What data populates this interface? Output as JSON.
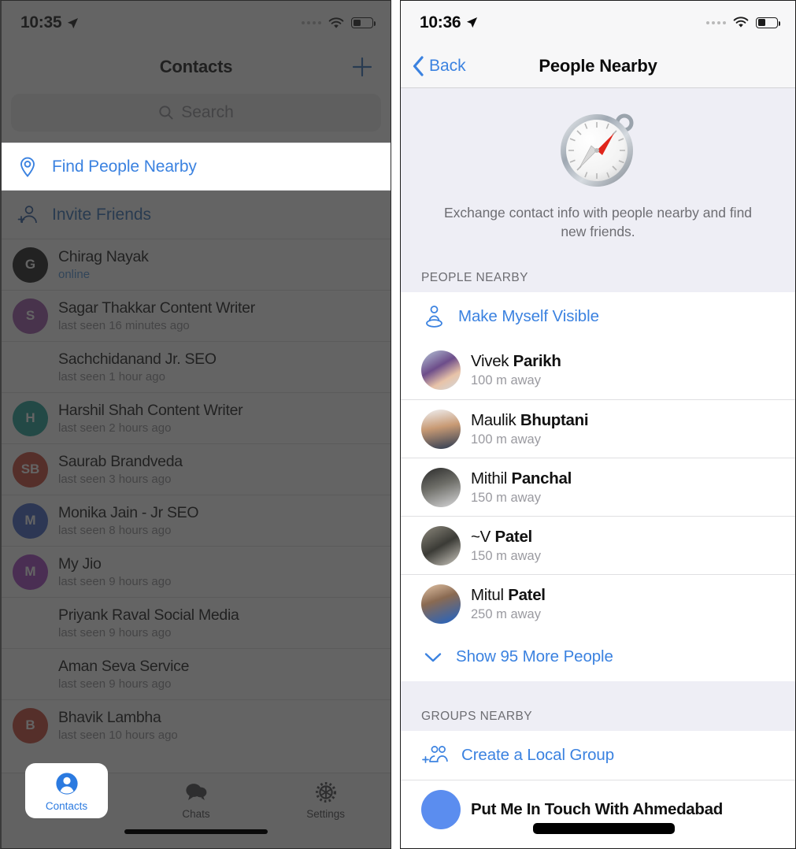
{
  "left": {
    "statusbar": {
      "time": "10:35",
      "location_icon": "location-arrow-icon",
      "signal_icon": "cell-signal-dots-icon",
      "wifi_icon": "wifi-icon",
      "battery_icon": "battery-icon"
    },
    "nav": {
      "title": "Contacts",
      "add_icon": "plus-icon"
    },
    "search": {
      "placeholder": "Search",
      "icon": "search-icon"
    },
    "find_nearby": {
      "label": "Find People Nearby",
      "icon": "location-pin-icon"
    },
    "invite": {
      "label": "Invite Friends",
      "icon": "add-person-icon"
    },
    "contacts": [
      {
        "name": "Chirag Nayak",
        "status": "online",
        "online": true,
        "initials": "G",
        "color": "#121212"
      },
      {
        "name": "Sagar Thakkar Content Writer",
        "status": "last seen 16 minutes ago",
        "online": false,
        "initials": "S",
        "color": "#9b4fa8"
      },
      {
        "name": "Sachchidanand Jr. SEO",
        "status": "last seen 1 hour ago",
        "online": false,
        "initials": "",
        "color": "transparent"
      },
      {
        "name": "Harshil Shah Content Writer",
        "status": "last seen 2 hours ago",
        "online": false,
        "initials": "H",
        "color": "#169e92"
      },
      {
        "name": "Saurab Brandveda",
        "status": "last seen 3 hours ago",
        "online": false,
        "initials": "SB",
        "color": "#c9402f"
      },
      {
        "name": "Monika Jain - Jr SEO",
        "status": "last seen 8 hours ago",
        "online": false,
        "initials": "M",
        "color": "#3b5fc4"
      },
      {
        "name": "My Jio",
        "status": "last seen 9 hours ago",
        "online": false,
        "initials": "M",
        "color": "#a03fc0"
      },
      {
        "name": "Priyank Raval Social Media",
        "status": "last seen 9 hours ago",
        "online": false,
        "initials": "",
        "color": "transparent"
      },
      {
        "name": "Aman Seva Service",
        "status": "last seen 9 hours ago",
        "online": false,
        "initials": "",
        "color": "transparent"
      },
      {
        "name": "Bhavik Lambha",
        "status": "last seen 10 hours ago",
        "online": false,
        "initials": "B",
        "color": "#c9402f"
      }
    ],
    "tabs": [
      {
        "label": "Contacts",
        "icon": "person-circle-icon",
        "active": true
      },
      {
        "label": "Chats",
        "icon": "chat-bubbles-icon",
        "active": false
      },
      {
        "label": "Settings",
        "icon": "gear-icon",
        "active": false
      }
    ]
  },
  "right": {
    "statusbar": {
      "time": "10:36",
      "location_icon": "location-arrow-icon",
      "signal_icon": "cell-signal-dots-icon",
      "wifi_icon": "wifi-icon",
      "battery_icon": "battery-icon"
    },
    "nav": {
      "back_label": "Back",
      "back_icon": "chevron-left-icon",
      "title": "People Nearby"
    },
    "hero": {
      "icon": "compass-icon",
      "text": "Exchange contact info with people nearby and find new friends."
    },
    "people_section": {
      "header": "PEOPLE NEARBY",
      "make_visible": {
        "label": "Make Myself Visible",
        "icon": "visible-person-icon"
      },
      "people": [
        {
          "first": "Vivek",
          "last": "Parikh",
          "distance": "100 m away"
        },
        {
          "first": "Maulik",
          "last": "Bhuptani",
          "distance": "100 m away"
        },
        {
          "first": "Mithil",
          "last": "Panchal",
          "distance": "150 m away"
        },
        {
          "first": "~V",
          "last": "Patel",
          "distance": "150 m away"
        },
        {
          "first": "Mitul",
          "last": "Patel",
          "distance": "250 m away"
        }
      ],
      "show_more": {
        "label": "Show 95 More People",
        "icon": "chevron-down-icon"
      }
    },
    "groups_section": {
      "header": "GROUPS NEARBY",
      "create_group": {
        "label": "Create a Local Group",
        "icon": "add-group-icon"
      },
      "groups": [
        {
          "name": "Put Me In Touch With Ahmedabad"
        }
      ]
    }
  },
  "colors": {
    "accent_blue": "#3b82e0",
    "section_bg": "#eeeef5",
    "muted_text": "#8b8b90",
    "dim_overlay": "rgba(40,40,40,0.72)"
  }
}
